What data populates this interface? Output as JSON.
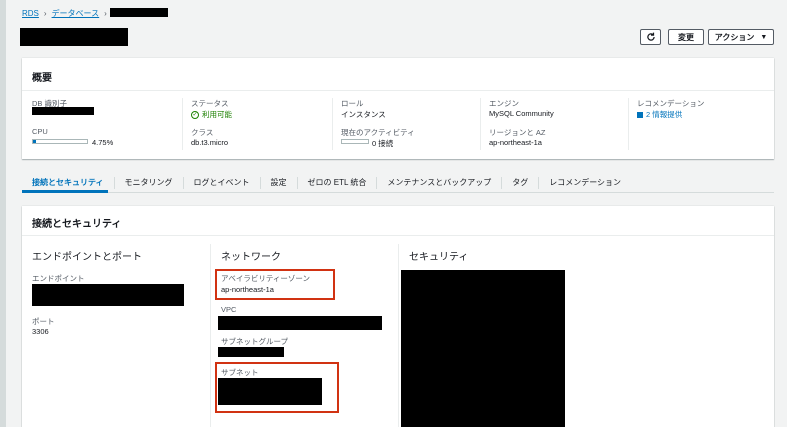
{
  "breadcrumb": {
    "rds": "RDS",
    "databases": "データベース",
    "sep": "›"
  },
  "header": {
    "edit_label": "変更",
    "actions_label": "アクション",
    "actions_caret": "▼"
  },
  "summary": {
    "title": "概要",
    "db_id_label": "DB 識別子",
    "cpu_label": "CPU",
    "cpu_value": "4.75%",
    "cpu_fraction": 0.0475,
    "status_label": "ステータス",
    "status_value": "利用可能",
    "status_check": "✓",
    "class_label": "クラス",
    "class_value": "db.t3.micro",
    "role_label": "ロール",
    "role_value": "インスタンス",
    "activity_label": "現在のアクティビティ",
    "activity_value": "0 接続",
    "activity_fraction": 0,
    "engine_label": "エンジン",
    "engine_value": "MySQL Community",
    "region_label": "リージョンと AZ",
    "region_value": "ap-northeast-1a",
    "recommend_label": "レコメンデーション",
    "recommend_value": "2 情報提供"
  },
  "tabs": [
    {
      "label": "接続とセキュリティ"
    },
    {
      "label": "モニタリング"
    },
    {
      "label": "ログとイベント"
    },
    {
      "label": "設定"
    },
    {
      "label": "ゼロの ETL 統合"
    },
    {
      "label": "メンテナンスとバックアップ"
    },
    {
      "label": "タグ"
    },
    {
      "label": "レコメンデーション"
    }
  ],
  "connectivity": {
    "title": "接続とセキュリティ",
    "endpoint_section": "エンドポイントとポート",
    "endpoint_label": "エンドポイント",
    "port_label": "ポート",
    "port_value": "3306",
    "network_section": "ネットワーク",
    "az_label": "アベイラビリティーゾーン",
    "az_value": "ap-northeast-1a",
    "vpc_label": "VPC",
    "subnet_group_label": "サブネットグループ",
    "subnet_label": "サブネット",
    "security_section": "セキュリティ"
  },
  "colors": {
    "link": "#0073bb",
    "success": "#1d8102",
    "highlight": "#d13212"
  }
}
